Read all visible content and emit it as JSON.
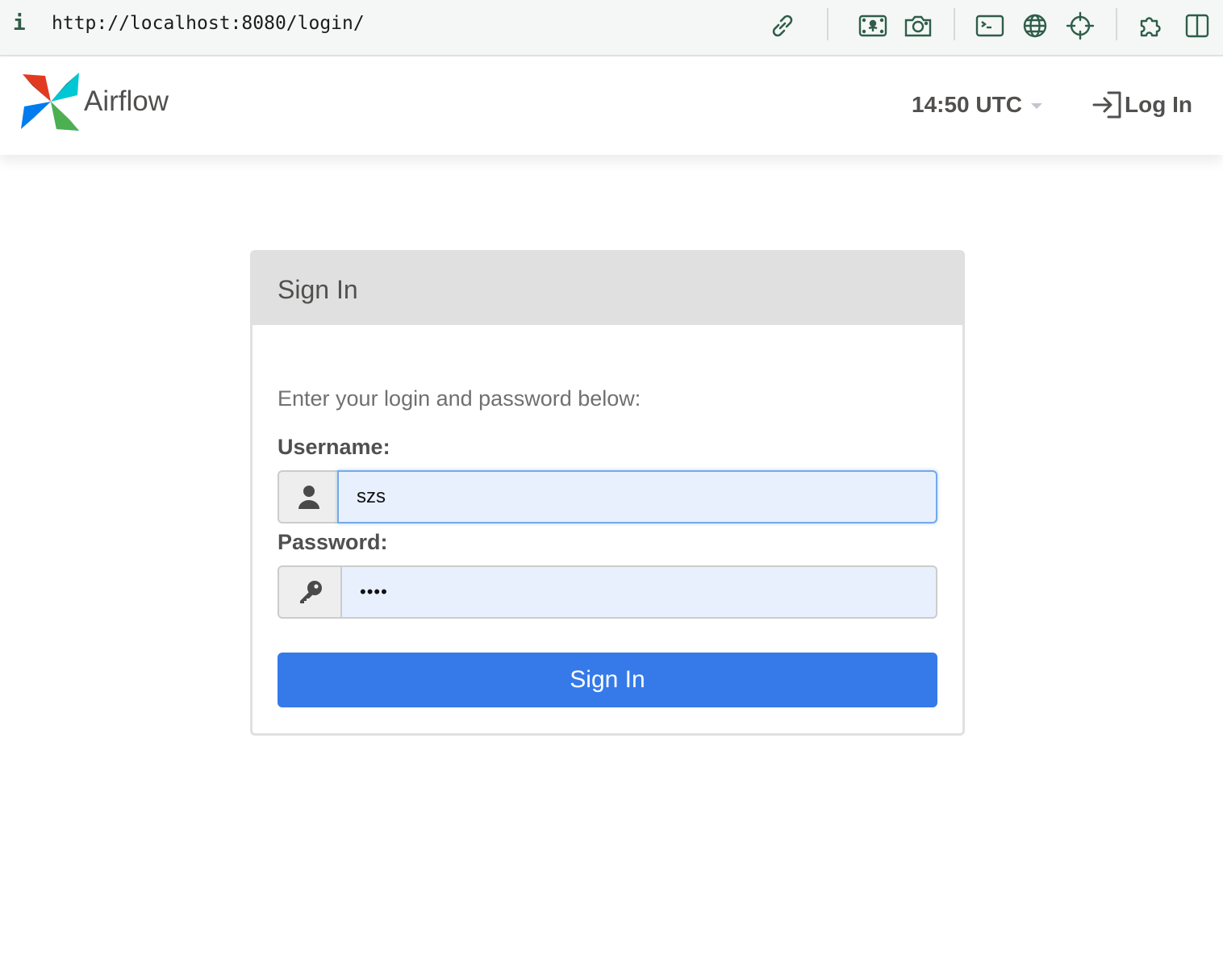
{
  "browser": {
    "info_glyph": "i",
    "url": "http://localhost:8080/login/",
    "toolbar_icons": [
      "link-icon",
      "flower-screenshot-icon",
      "camera-icon",
      "terminal-icon",
      "globe-icon",
      "crosshair-icon",
      "extension-puzzle-icon",
      "split-view-icon"
    ]
  },
  "navbar": {
    "brand": "Airflow",
    "clock": "14:50 UTC",
    "login_label": "Log In"
  },
  "login_panel": {
    "title": "Sign In",
    "instructions": "Enter your login and password below:",
    "username_label": "Username:",
    "username_value": "szs",
    "password_label": "Password:",
    "password_value": "••••",
    "submit_label": "Sign In"
  },
  "colors": {
    "primary": "#357ae8",
    "panel_heading": "#e0e0e0",
    "text": "#51504f",
    "autofill_bg": "#e8f0fe"
  }
}
